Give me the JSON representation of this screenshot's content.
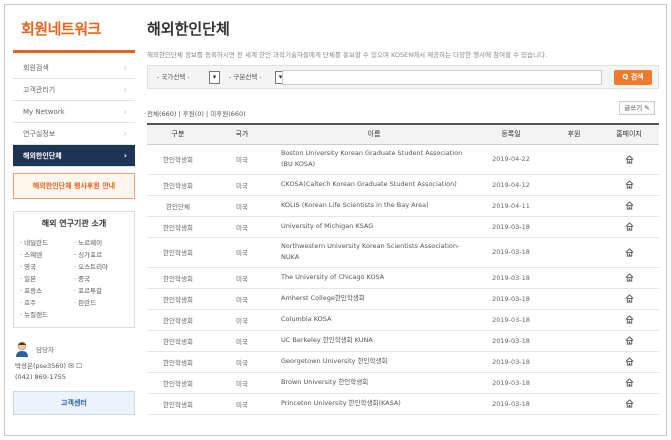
{
  "sidebar": {
    "title": "회원네트워크",
    "menu": [
      {
        "label": "회원검색",
        "active": false
      },
      {
        "label": "고객관리기",
        "active": false
      },
      {
        "label": "My Network",
        "active": false
      },
      {
        "label": "연구실정보",
        "active": false
      },
      {
        "label": "해외한인단체",
        "active": true
      }
    ],
    "sub_link": "해외한인단체 행사후원 안내",
    "org": {
      "title": "해외 연구기관 소개",
      "countries": [
        "네덜란드",
        "노르웨이",
        "스웨덴",
        "싱가포르",
        "영국",
        "오스트리아",
        "일본",
        "중국",
        "프랑스",
        "포르투갈",
        "호주",
        "핀란드",
        "뉴질랜드"
      ]
    },
    "contact": {
      "tag": "담당자",
      "name_line": "박성은(pse3560)",
      "phone": "(042) 869-1755"
    },
    "center_button": "고객센터"
  },
  "main": {
    "title": "해외한인단체",
    "description": "해외한인단체 정보를 등록하시면 전 세계 한인 과학기술자들에게 단체를 홍보할 수 있으며 KOSEN에서 제공하는 다양한 행사에 참여할 수 있습니다.",
    "search": {
      "country_select": "- 국가선택 -",
      "type_select": "- 구분선택 -",
      "input_value": "",
      "button": "Q 검색"
    },
    "counts": "전체(660) | 후원(0) | 미후원(660)",
    "write_button": "글쓰기",
    "columns": [
      "구분",
      "국가",
      "이름",
      "등록일",
      "후원",
      "홈페이지"
    ],
    "rows": [
      {
        "type": "한인학생회",
        "country": "미국",
        "name": "Boston University Korean Graduate Student Association (BU KOSA)",
        "date": "2019-04-22",
        "sponsor": "",
        "tall": true
      },
      {
        "type": "한인학생회",
        "country": "미국",
        "name": "CKOSA(Caltech Korean Graduate Student Association)",
        "date": "2019-04-12",
        "sponsor": "",
        "tall": false
      },
      {
        "type": "한인단체",
        "country": "미국",
        "name": "KOLIS (Korean Life Scientists in the Bay Area)",
        "date": "2019-04-11",
        "sponsor": "",
        "tall": false
      },
      {
        "type": "한인학생회",
        "country": "미국",
        "name": "University of Michigan KSAG",
        "date": "2019-03-18",
        "sponsor": "",
        "tall": false
      },
      {
        "type": "한인학생회",
        "country": "미국",
        "name": "Northwestern University Korean Scientists Association-NUKA",
        "date": "2019-03-18",
        "sponsor": "",
        "tall": true
      },
      {
        "type": "한인학생회",
        "country": "미국",
        "name": "The University of Chicago KOSA",
        "date": "2019-03-18",
        "sponsor": "",
        "tall": false
      },
      {
        "type": "한인학생회",
        "country": "미국",
        "name": "Amherst College한인학생회",
        "date": "2019-03-18",
        "sponsor": "",
        "tall": false
      },
      {
        "type": "한인학생회",
        "country": "미국",
        "name": "Columbia KOSA",
        "date": "2019-03-18",
        "sponsor": "",
        "tall": false
      },
      {
        "type": "한인학생회",
        "country": "미국",
        "name": "UC Berkeley 한인학생회 KUNA",
        "date": "2019-03-18",
        "sponsor": "",
        "tall": false
      },
      {
        "type": "한인학생회",
        "country": "미국",
        "name": "Georgetown University 한인학생회",
        "date": "2019-03-18",
        "sponsor": "",
        "tall": false
      },
      {
        "type": "한인학생회",
        "country": "미국",
        "name": "Brown University 한인학생회",
        "date": "2019-03-18",
        "sponsor": "",
        "tall": false
      },
      {
        "type": "한인학생회",
        "country": "미국",
        "name": "Princeton University 한인학생회(KASA)",
        "date": "2019-03-18",
        "sponsor": "",
        "tall": false
      }
    ]
  },
  "colors": {
    "brand_orange": "#e8641e",
    "nav_active": "#1e3454",
    "search_button": "#f07a2b"
  },
  "icons": {
    "menu_arrow": "chevron-right-icon",
    "homepage": "home-icon",
    "contact_avatar": "person-icon"
  }
}
